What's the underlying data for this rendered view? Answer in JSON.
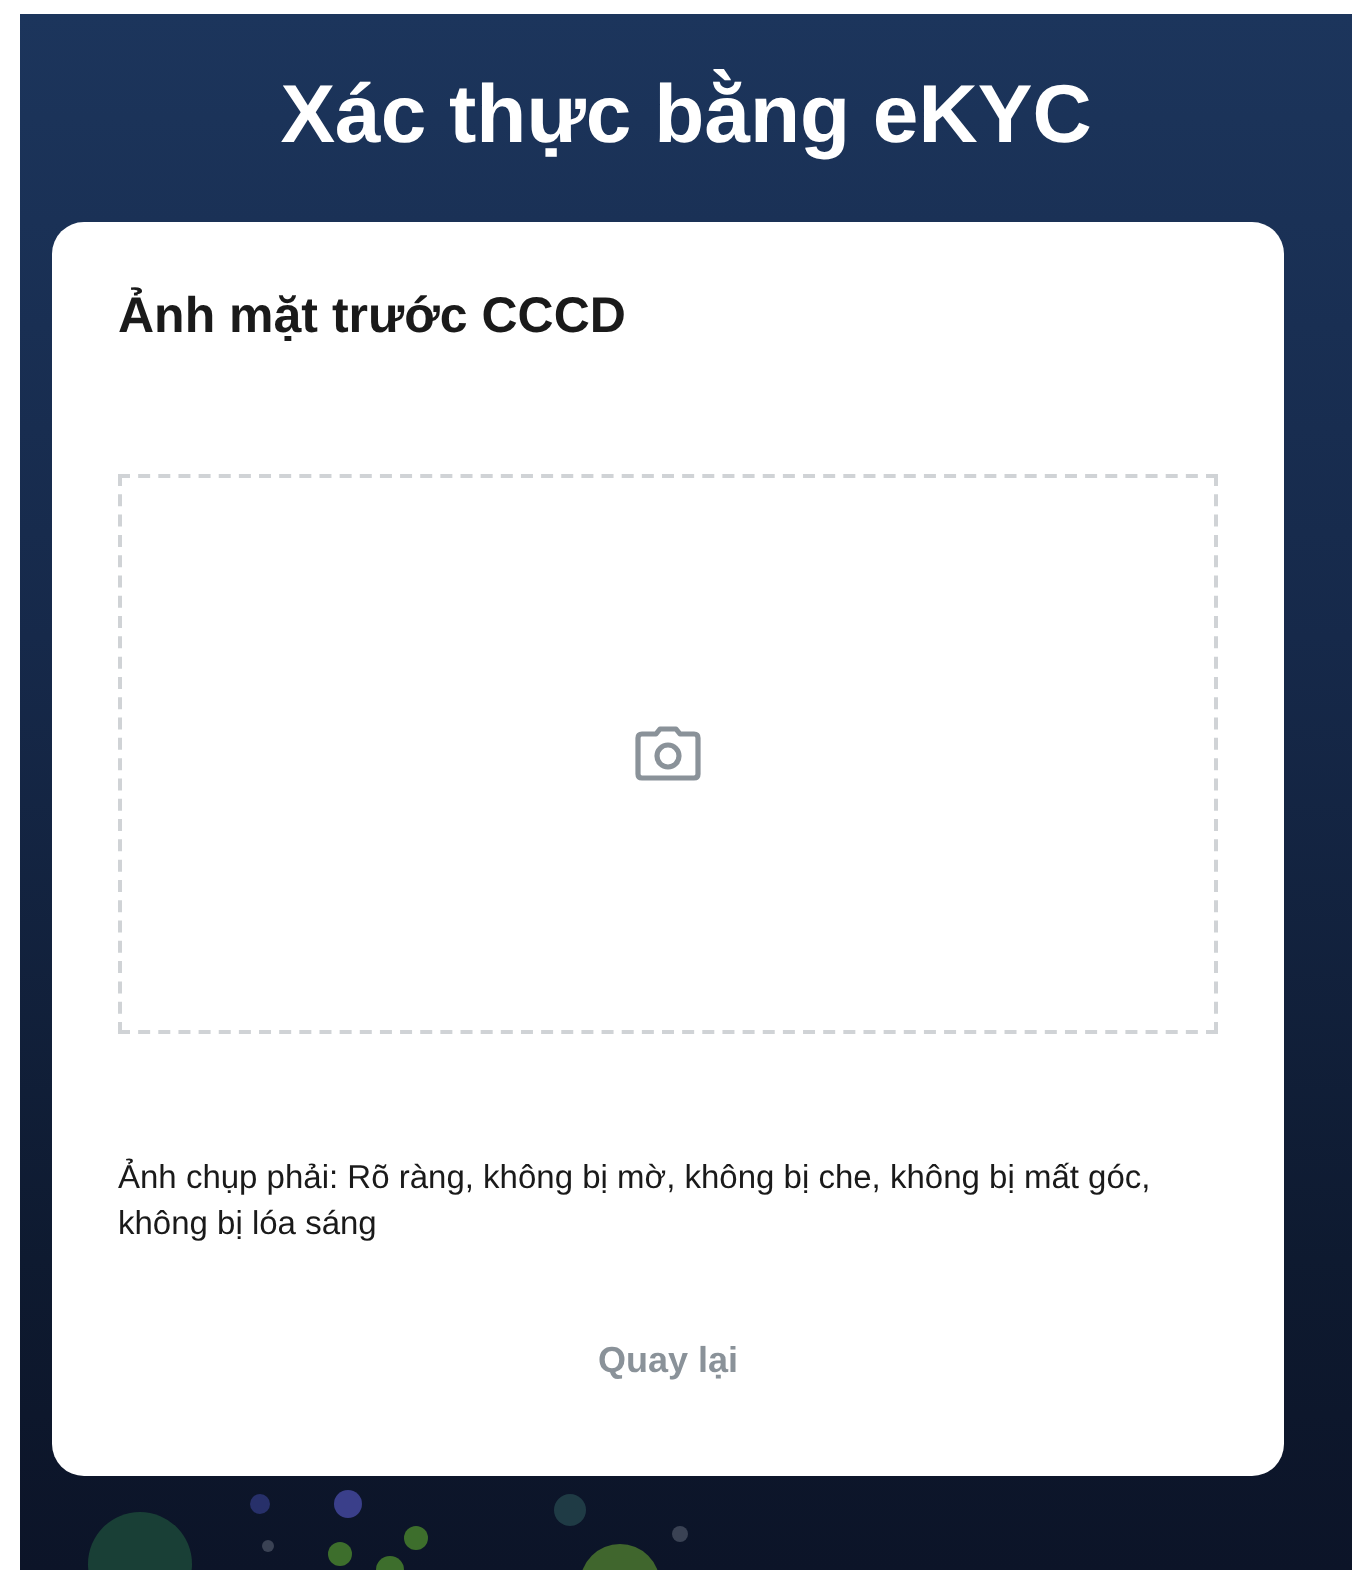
{
  "page_title": "Xác thực bằng eKYC",
  "card": {
    "title": "Ảnh mặt trước CCCD",
    "upload_area": {
      "kind": "camera"
    },
    "hint": "Ảnh chụp phải: Rõ ràng, không bị mờ, không bị che, không bị mất góc, không bị lóa sáng",
    "back_button": {
      "label": "Quay lại",
      "disabled": true
    }
  }
}
